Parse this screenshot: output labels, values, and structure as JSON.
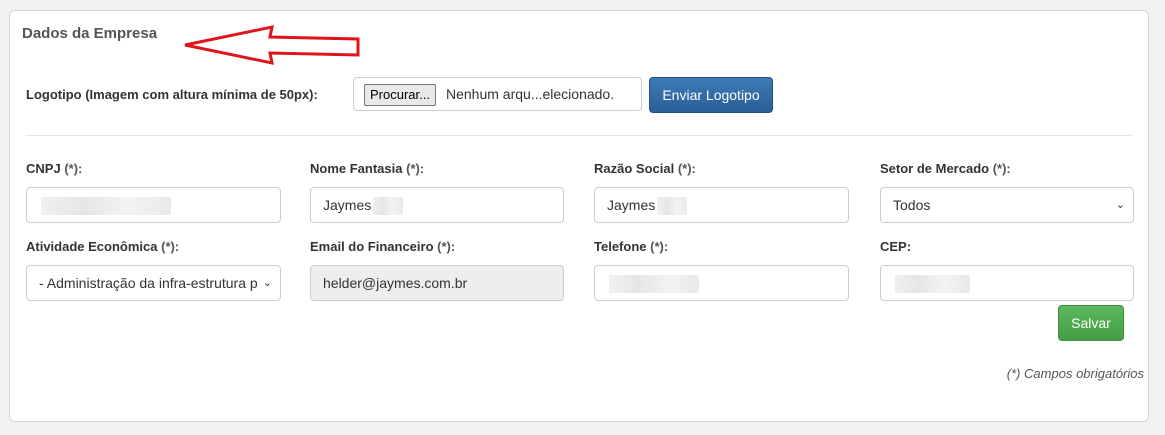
{
  "panel": {
    "title": "Dados da Empresa"
  },
  "logo": {
    "label": "Logotipo (Imagem com altura mínima de 50px):",
    "browse_label": "Procurar...",
    "file_status": "Nenhum arqu...elecionado.",
    "send_label": "Enviar Logotipo"
  },
  "fields": {
    "cnpj": {
      "label": "CNPJ",
      "req": "(*):",
      "value": ""
    },
    "nome_fantasia": {
      "label": "Nome Fantasia",
      "req": "(*):",
      "value": "Jaymes"
    },
    "razao_social": {
      "label": "Razão Social",
      "req": "(*):",
      "value": "Jaymes"
    },
    "setor_mercado": {
      "label": "Setor de Mercado",
      "req": "(*):",
      "value": "Todos"
    },
    "atividade": {
      "label": "Atividade Econômica",
      "req": "(*):",
      "value": "- Administração da infra-estrutura p"
    },
    "email_financeiro": {
      "label": "Email do Financeiro",
      "req": "(*):",
      "value": "helder@jaymes.com.br"
    },
    "telefone": {
      "label": "Telefone",
      "req": "(*):",
      "value": ""
    },
    "cep": {
      "label": "CEP:",
      "value": ""
    }
  },
  "actions": {
    "save_label": "Salvar"
  },
  "note": "(*) Campos obrigatórios",
  "colors": {
    "primary": "#2a5f97",
    "success": "#449d44",
    "annotation": "#e0141b"
  },
  "icons": {
    "select_caret": "chevron-down-icon",
    "annotation": "arrow-left-icon"
  }
}
